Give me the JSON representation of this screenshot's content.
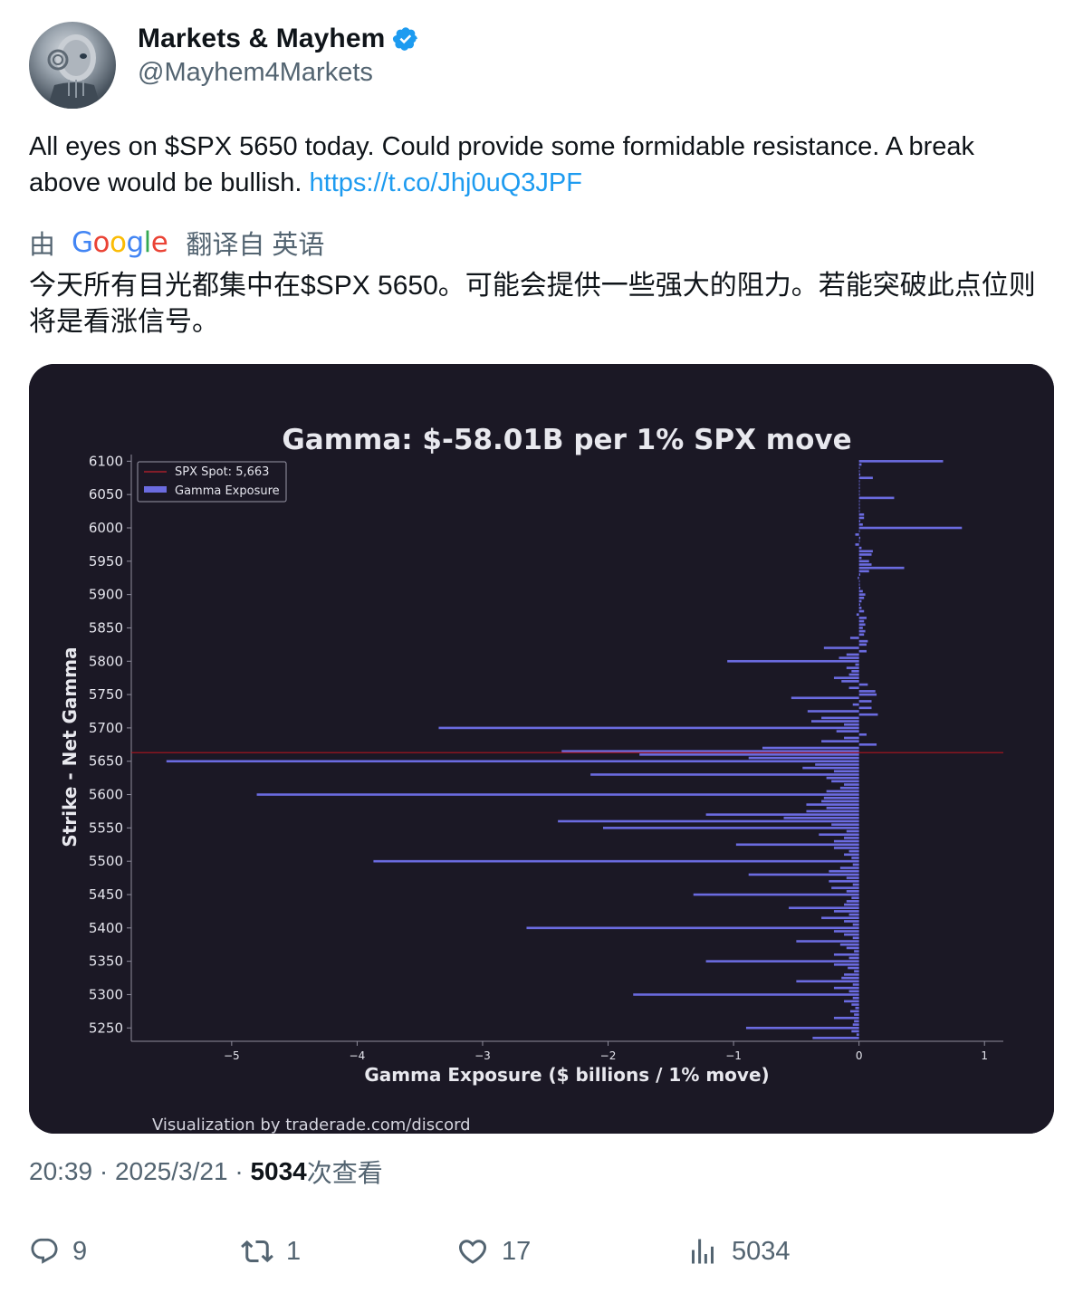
{
  "author": {
    "display_name": "Markets & Mayhem",
    "handle": "@Mayhem4Markets",
    "verified_icon": "verified-badge-icon"
  },
  "tweet": {
    "text": "All eyes on $SPX 5650 today. Could provide some formidable resistance. A break above would be bullish. ",
    "link": "https://t.co/Jhj0uQ3JPF"
  },
  "translation": {
    "by_label": "由",
    "provider_letters": [
      "G",
      "o",
      "o",
      "g",
      "l",
      "e"
    ],
    "suffix": "翻译自 英语",
    "text": "今天所有目光都集中在$SPX 5650。可能会提供一些强大的阻力。若能突破此点位则将是看涨信号。"
  },
  "meta": {
    "time": "20:39",
    "separator": "·",
    "date": "2025/3/21",
    "views_count": "5034",
    "views_label": "次查看"
  },
  "actions": {
    "replies": "9",
    "reposts": "1",
    "likes": "17",
    "views": "5034"
  },
  "colors": {
    "chart_bg": "#1b1825",
    "bar": "#6b6be0",
    "spot_line": "#b0151f",
    "link": "#1d9bf0",
    "verified": "#1d9bf0"
  },
  "chart_data": {
    "type": "bar",
    "orientation": "horizontal",
    "title": "Gamma: $-58.01B per 1% SPX move",
    "xlabel": "Gamma Exposure ($ billions / 1% move)",
    "ylabel": "Strike - Net Gamma",
    "xlim": [
      -5.8,
      1.15
    ],
    "ylim": [
      5230,
      6110
    ],
    "x_ticks": [
      -5,
      -4,
      -3,
      -2,
      -1,
      0,
      1
    ],
    "x_tick_labels": [
      "−5",
      "−4",
      "−3",
      "−2",
      "−1",
      "0",
      "1"
    ],
    "y_ticks": [
      5250,
      5300,
      5350,
      5400,
      5450,
      5500,
      5550,
      5600,
      5650,
      5700,
      5750,
      5800,
      5850,
      5900,
      5950,
      6000,
      6050,
      6100
    ],
    "legend": {
      "placement": "top-left",
      "entries": [
        "SPX Spot: 5,663",
        "Gamma Exposure"
      ]
    },
    "spot": 5663,
    "credit": "Visualization by traderade.com/discord",
    "series": [
      {
        "name": "Gamma Exposure",
        "points": [
          [
            5235,
            -0.37
          ],
          [
            5240,
            -0.02
          ],
          [
            5245,
            -0.06
          ],
          [
            5250,
            -0.9
          ],
          [
            5255,
            -0.05
          ],
          [
            5260,
            -0.04
          ],
          [
            5265,
            -0.2
          ],
          [
            5270,
            -0.04
          ],
          [
            5275,
            -0.07
          ],
          [
            5280,
            -0.03
          ],
          [
            5285,
            -0.06
          ],
          [
            5290,
            -0.12
          ],
          [
            5295,
            -0.05
          ],
          [
            5300,
            -1.8
          ],
          [
            5305,
            -0.08
          ],
          [
            5310,
            -0.2
          ],
          [
            5315,
            -0.05
          ],
          [
            5320,
            -0.5
          ],
          [
            5325,
            -0.14
          ],
          [
            5330,
            -0.12
          ],
          [
            5335,
            -0.04
          ],
          [
            5340,
            -0.09
          ],
          [
            5345,
            -0.2
          ],
          [
            5350,
            -1.22
          ],
          [
            5355,
            -0.08
          ],
          [
            5360,
            -0.2
          ],
          [
            5365,
            -0.04
          ],
          [
            5370,
            -0.1
          ],
          [
            5375,
            -0.15
          ],
          [
            5380,
            -0.5
          ],
          [
            5385,
            -0.05
          ],
          [
            5390,
            -0.12
          ],
          [
            5395,
            -0.2
          ],
          [
            5400,
            -2.65
          ],
          [
            5405,
            -0.05
          ],
          [
            5410,
            -0.12
          ],
          [
            5415,
            -0.3
          ],
          [
            5420,
            -0.08
          ],
          [
            5425,
            -0.2
          ],
          [
            5430,
            -0.56
          ],
          [
            5435,
            -0.12
          ],
          [
            5440,
            -0.1
          ],
          [
            5445,
            -0.06
          ],
          [
            5450,
            -1.32
          ],
          [
            5455,
            -0.1
          ],
          [
            5460,
            -0.22
          ],
          [
            5465,
            -0.05
          ],
          [
            5470,
            -0.24
          ],
          [
            5475,
            -0.1
          ],
          [
            5480,
            -0.88
          ],
          [
            5485,
            -0.24
          ],
          [
            5490,
            -0.15
          ],
          [
            5495,
            -0.05
          ],
          [
            5500,
            -3.87
          ],
          [
            5505,
            -0.06
          ],
          [
            5510,
            -0.12
          ],
          [
            5515,
            -0.08
          ],
          [
            5520,
            -0.2
          ],
          [
            5525,
            -0.98
          ],
          [
            5530,
            -0.2
          ],
          [
            5535,
            -0.12
          ],
          [
            5540,
            -0.32
          ],
          [
            5545,
            -0.1
          ],
          [
            5550,
            -2.04
          ],
          [
            5555,
            -0.22
          ],
          [
            5560,
            -2.4
          ],
          [
            5565,
            -0.6
          ],
          [
            5570,
            -1.22
          ],
          [
            5575,
            -0.42
          ],
          [
            5580,
            -0.26
          ],
          [
            5585,
            -0.42
          ],
          [
            5590,
            -0.3
          ],
          [
            5595,
            -0.28
          ],
          [
            5600,
            -4.8
          ],
          [
            5605,
            -0.26
          ],
          [
            5610,
            -0.15
          ],
          [
            5615,
            -0.12
          ],
          [
            5620,
            -0.22
          ],
          [
            5625,
            -0.26
          ],
          [
            5630,
            -2.14
          ],
          [
            5635,
            -0.2
          ],
          [
            5640,
            -0.45
          ],
          [
            5645,
            -0.35
          ],
          [
            5650,
            -5.52
          ],
          [
            5655,
            -0.88
          ],
          [
            5660,
            -1.75
          ],
          [
            5665,
            -2.37
          ],
          [
            5670,
            -0.77
          ],
          [
            5675,
            0.14
          ],
          [
            5680,
            -0.3
          ],
          [
            5685,
            -0.12
          ],
          [
            5690,
            0.06
          ],
          [
            5695,
            -0.18
          ],
          [
            5700,
            -3.35
          ],
          [
            5705,
            -0.12
          ],
          [
            5710,
            -0.38
          ],
          [
            5715,
            -0.3
          ],
          [
            5720,
            0.15
          ],
          [
            5725,
            -0.41
          ],
          [
            5730,
            0.1
          ],
          [
            5735,
            -0.05
          ],
          [
            5740,
            0.1
          ],
          [
            5745,
            -0.54
          ],
          [
            5750,
            0.14
          ],
          [
            5755,
            0.13
          ],
          [
            5760,
            -0.08
          ],
          [
            5765,
            0.07
          ],
          [
            5770,
            -0.14
          ],
          [
            5775,
            -0.2
          ],
          [
            5780,
            -0.08
          ],
          [
            5785,
            -0.06
          ],
          [
            5790,
            -0.1
          ],
          [
            5795,
            -0.03
          ],
          [
            5800,
            -1.05
          ],
          [
            5805,
            -0.16
          ],
          [
            5810,
            -0.1
          ],
          [
            5815,
            0.06
          ],
          [
            5820,
            -0.28
          ],
          [
            5825,
            0.06
          ],
          [
            5830,
            0.07
          ],
          [
            5835,
            -0.07
          ],
          [
            5840,
            0.04
          ],
          [
            5845,
            0.05
          ],
          [
            5850,
            0.03
          ],
          [
            5855,
            0.05
          ],
          [
            5860,
            0.04
          ],
          [
            5865,
            0.06
          ],
          [
            5870,
            -0.02
          ],
          [
            5875,
            0.04
          ],
          [
            5880,
            0.02
          ],
          [
            5885,
            0.01
          ],
          [
            5890,
            0.02
          ],
          [
            5895,
            0.04
          ],
          [
            5900,
            0.05
          ],
          [
            5905,
            0.03
          ],
          [
            5910,
            0.01
          ],
          [
            5915,
            0.0
          ],
          [
            5920,
            0.0
          ],
          [
            5925,
            -0.01
          ],
          [
            5930,
            0.01
          ],
          [
            5935,
            0.08
          ],
          [
            5940,
            0.36
          ],
          [
            5945,
            0.1
          ],
          [
            5950,
            0.08
          ],
          [
            5955,
            0.02
          ],
          [
            5960,
            0.1
          ],
          [
            5965,
            0.11
          ],
          [
            5970,
            0.02
          ],
          [
            5975,
            -0.03
          ],
          [
            5980,
            0.0
          ],
          [
            5985,
            0.01
          ],
          [
            5990,
            -0.03
          ],
          [
            5995,
            0.0
          ],
          [
            6000,
            0.82
          ],
          [
            6005,
            0.03
          ],
          [
            6010,
            0.01
          ],
          [
            6015,
            0.04
          ],
          [
            6020,
            0.04
          ],
          [
            6025,
            0.0
          ],
          [
            6030,
            0.0
          ],
          [
            6035,
            0.0
          ],
          [
            6040,
            0.0
          ],
          [
            6045,
            0.28
          ],
          [
            6050,
            0.0
          ],
          [
            6055,
            0.0
          ],
          [
            6060,
            0.0
          ],
          [
            6065,
            0.0
          ],
          [
            6070,
            0.0
          ],
          [
            6075,
            0.11
          ],
          [
            6080,
            0.01
          ],
          [
            6085,
            0.0
          ],
          [
            6090,
            0.0
          ],
          [
            6095,
            0.02
          ],
          [
            6100,
            0.67
          ]
        ]
      }
    ]
  }
}
